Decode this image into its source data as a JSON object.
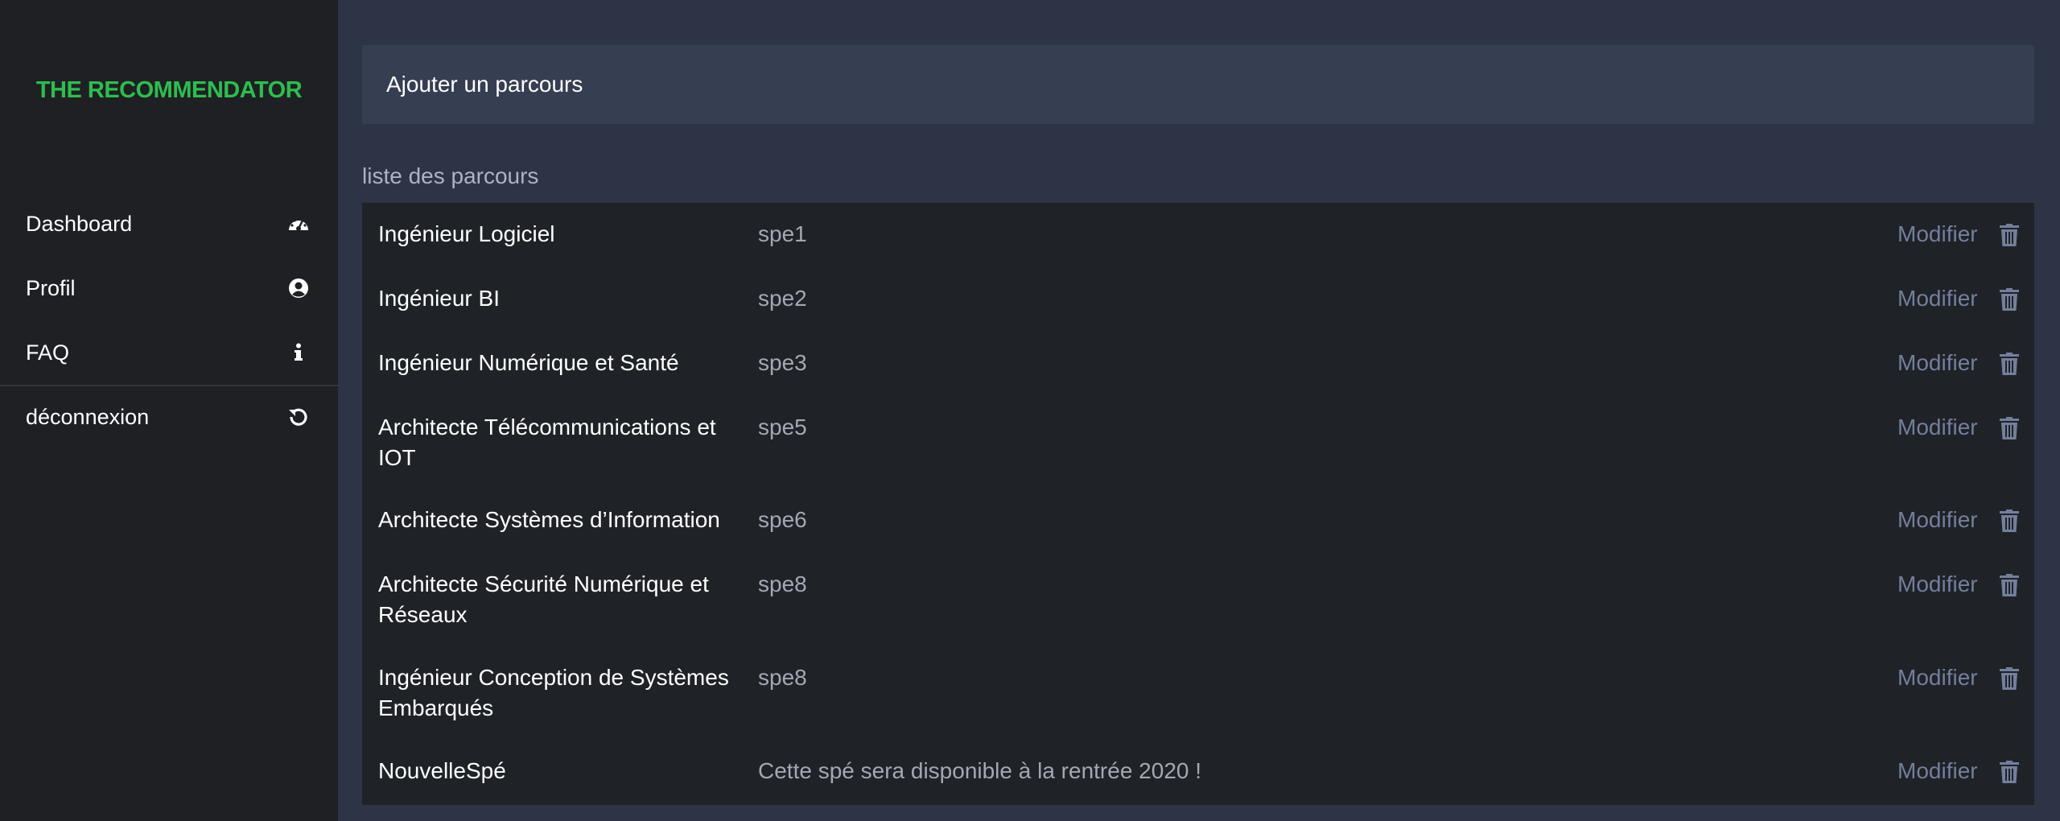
{
  "app": {
    "brand": "THE RECOMMENDATOR",
    "brand_color": "#2ebd4f"
  },
  "sidebar": {
    "items": [
      {
        "label": "Dashboard",
        "icon": "dashboard-icon"
      },
      {
        "label": "Profil",
        "icon": "user-circle-icon"
      },
      {
        "label": "FAQ",
        "icon": "info-icon"
      },
      {
        "label": "déconnexion",
        "icon": "refresh-icon"
      }
    ]
  },
  "main": {
    "add_button_label": "Ajouter un parcours",
    "list_title": "liste des parcours",
    "modify_label": "Modifier",
    "rows": [
      {
        "name": "Ingénieur Logiciel",
        "code": "spe1"
      },
      {
        "name": "Ingénieur BI",
        "code": "spe2"
      },
      {
        "name": "Ingénieur Numérique et Santé",
        "code": "spe3"
      },
      {
        "name": "Architecte Télécommunications et IOT",
        "code": "spe5"
      },
      {
        "name": "Architecte Systèmes d’Information",
        "code": "spe6"
      },
      {
        "name": "Architecte Sécurité Numérique et Réseaux",
        "code": "spe8"
      },
      {
        "name": "Ingénieur Conception de Systèmes Embarqués",
        "code": "spe8"
      },
      {
        "name": "NouvelleSpé",
        "code": "Cette spé sera disponible à la rentrée 2020 !"
      }
    ]
  }
}
